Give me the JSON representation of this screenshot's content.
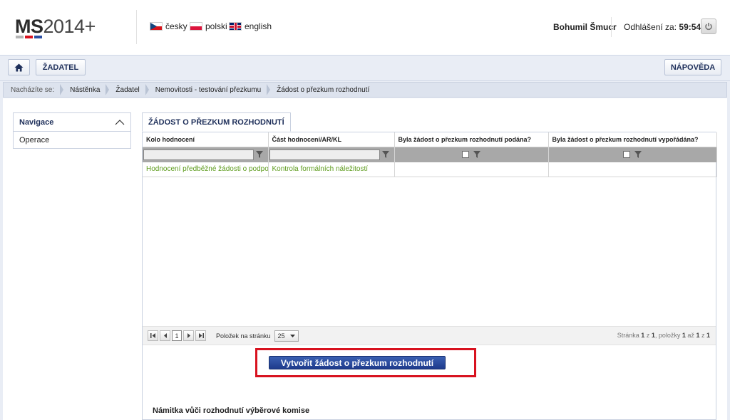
{
  "header": {
    "logo_main": "MS",
    "logo_suffix": "2014+",
    "languages": [
      {
        "label": "česky",
        "flag": "cz"
      },
      {
        "label": "polski",
        "flag": "pl"
      },
      {
        "label": "english",
        "flag": "en"
      }
    ],
    "user_name": "Bohumil Šmucr",
    "logout_label": "Odhlášení za:",
    "logout_timer": "59:54",
    "logo_colors": [
      "#b5b5b5",
      "#d8121f",
      "#2b4ea2"
    ]
  },
  "toolbar": {
    "home_icon": "home-icon",
    "applicant_label": "ŽADATEL",
    "help_label": "NÁPOVĚDA"
  },
  "breadcrumb": {
    "prefix": "Nacházíte se:",
    "items": [
      "Nástěnka",
      "Žadatel",
      "Nemovitosti - testování přezkumu",
      "Žádost o přezkum rozhodnutí"
    ]
  },
  "sidenav": {
    "title": "Navigace",
    "items": [
      "Operace"
    ]
  },
  "panel": {
    "tab_label": "ŽÁDOST O PŘEZKUM ROZHODNUTÍ",
    "columns": [
      "Kolo hodnocení",
      "Část hodnocení/AR/KL",
      "Byla žádost o přezkum rozhodnutí podána?",
      "Byla žádost o přezkum rozhodnutí vypořádána?"
    ],
    "rows": [
      [
        "Hodnocení předběžné žádosti o podporu",
        "Kontrola formálních náležitostí",
        "",
        ""
      ]
    ]
  },
  "pager": {
    "current_page": "1",
    "per_page_label": "Položek na stránku",
    "per_page_value": "25",
    "info_prefix": "Stránka",
    "info_page": "1",
    "info_of": "z",
    "info_pages": "1",
    "info_items_label": ", položky",
    "info_from": "1",
    "info_to_label": "až",
    "info_to": "1",
    "info_total": "1"
  },
  "actions": {
    "create_label": "Vytvořit žádost o přezkum rozhodnutí"
  },
  "section": {
    "objection_title": "Námitka vůči rozhodnutí výběrové komise"
  }
}
